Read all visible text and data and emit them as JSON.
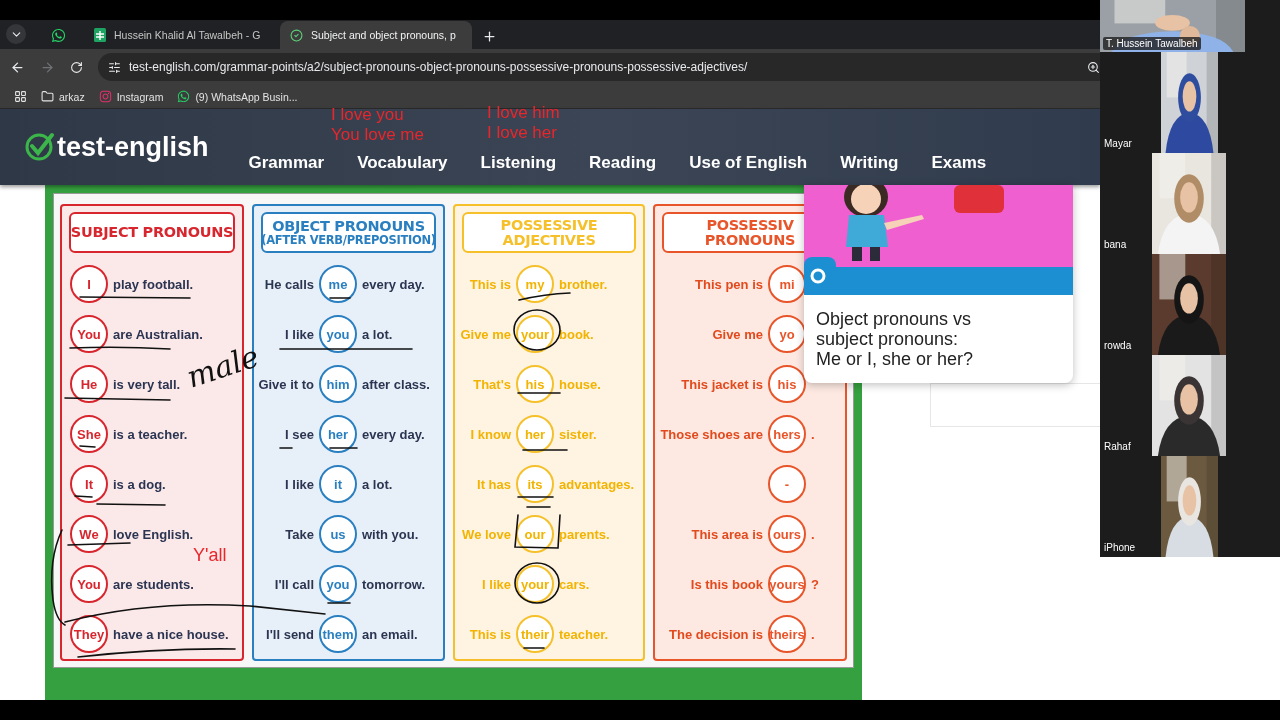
{
  "browser": {
    "tabs": [
      {
        "kind": "pinned",
        "selected": false
      },
      {
        "kind": "page",
        "title": "Hussein Khalid Al Tawalbeh - G",
        "selected": false
      },
      {
        "kind": "page",
        "title": "Subject and object pronouns, p",
        "selected": true
      }
    ],
    "url": "test-english.com/grammar-points/a2/subject-pronouns-object-pronouns-possessive-pronouns-possessive-adjectives/",
    "bookmarks": [
      {
        "kind": "folder",
        "label": "arkaz"
      },
      {
        "kind": "instagram",
        "label": "Instagram"
      },
      {
        "kind": "whatsapp",
        "label": "(9) WhatsApp Busin..."
      }
    ]
  },
  "site": {
    "logo": "test-english",
    "nav": [
      "Grammar",
      "Vocabulary",
      "Listening",
      "Reading",
      "Use of English",
      "Writing",
      "Exams"
    ]
  },
  "chart": {
    "columns": [
      {
        "title_lines": [
          "SUBJECT PRONOUNS"
        ],
        "color": "#d8262e",
        "rows": [
          {
            "pronoun": "I",
            "after": "play football."
          },
          {
            "pronoun": "You",
            "after": "are Australian."
          },
          {
            "pronoun": "He",
            "after": "is very tall."
          },
          {
            "pronoun": "She",
            "after": "is a teacher."
          },
          {
            "pronoun": "It",
            "after": "is a dog."
          },
          {
            "pronoun": "We",
            "after": "love English."
          },
          {
            "pronoun": "You",
            "after": "are students."
          },
          {
            "pronoun": "They",
            "after": "have a nice house."
          }
        ]
      },
      {
        "title_lines": [
          "OBJECT PRONOUNS",
          "(AFTER VERB/PREPOSITION)"
        ],
        "color": "#2a7fc0",
        "rows": [
          {
            "before": "He calls",
            "pronoun": "me",
            "after": "every day."
          },
          {
            "before": "I like",
            "pronoun": "you",
            "after": "a lot."
          },
          {
            "before": "Give it to",
            "pronoun": "him",
            "after": "after class."
          },
          {
            "before": "I see",
            "pronoun": "her",
            "after": "every day."
          },
          {
            "before": "I like",
            "pronoun": "it",
            "after": "a lot."
          },
          {
            "before": "Take",
            "pronoun": "us",
            "after": "with you."
          },
          {
            "before": "I'll call",
            "pronoun": "you",
            "after": "tomorrow."
          },
          {
            "before": "I'll send",
            "pronoun": "them",
            "after": "an email."
          }
        ]
      },
      {
        "title_lines": [
          "POSSESSIVE",
          "ADJECTIVES"
        ],
        "color": "#f5c02a",
        "rows": [
          {
            "before": "This is",
            "pronoun": "my",
            "after": "brother."
          },
          {
            "before": "Give me",
            "pronoun": "your",
            "after": "book."
          },
          {
            "before": "That's",
            "pronoun": "his",
            "after": "house."
          },
          {
            "before": "I know",
            "pronoun": "her",
            "after": "sister."
          },
          {
            "before": "It has",
            "pronoun": "its",
            "after": "advantages."
          },
          {
            "before": "We love",
            "pronoun": "our",
            "after": "parents."
          },
          {
            "before": "I like",
            "pronoun": "your",
            "after": "cars."
          },
          {
            "before": "This is",
            "pronoun": "their",
            "after": "teacher."
          }
        ]
      },
      {
        "title_lines": [
          "POSSESSIV",
          "PRONOUNS"
        ],
        "color": "#e8552a",
        "rows": [
          {
            "before": "This pen is",
            "pronoun": "mi"
          },
          {
            "before": "Give me",
            "pronoun": "yo"
          },
          {
            "before": "This jacket is",
            "pronoun": "his"
          },
          {
            "before": "Those shoes are",
            "pronoun": "hers",
            "after": "."
          },
          {
            "pronoun": "-"
          },
          {
            "before": "This area is",
            "pronoun": "ours",
            "after": "."
          },
          {
            "before": "Is this book",
            "pronoun": "yours",
            "after": "?"
          },
          {
            "before": "The decision is",
            "pronoun": "theirs",
            "after": "."
          }
        ]
      }
    ]
  },
  "popup": {
    "title": "Object pronouns vs subject pronouns: Me or I, she or her?"
  },
  "annotations": [
    {
      "text": "I love you",
      "color": "#e8262b"
    },
    {
      "text": "You love me",
      "color": "#e8262b"
    },
    {
      "text": "I love him",
      "color": "#e8262b"
    },
    {
      "text": "I love her",
      "color": "#e8262b"
    },
    {
      "text": "male",
      "color": "#111111"
    },
    {
      "text": "Y'all",
      "color": "#e8262b"
    }
  ],
  "participants": [
    {
      "name": "T. Hussein Tawalbeh",
      "kind": "host"
    },
    {
      "name": "Mayar",
      "kind": "narrow"
    },
    {
      "name": "bana",
      "kind": "wide"
    },
    {
      "name": "rowda",
      "kind": "wide"
    },
    {
      "name": "Rahaf",
      "kind": "wide"
    },
    {
      "name": "iPhone",
      "kind": "narrow"
    }
  ]
}
